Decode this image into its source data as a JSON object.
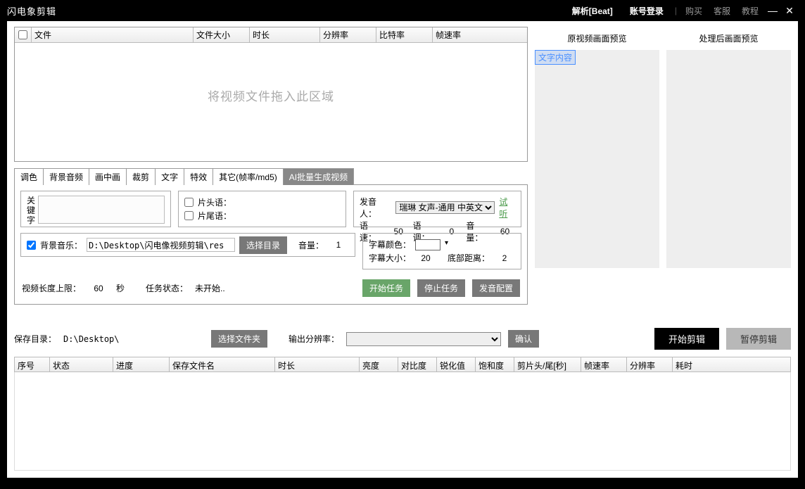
{
  "titlebar": {
    "title": "闪电象剪辑",
    "parse": "解析[Beat]",
    "login": "账号登录",
    "buy": "购买",
    "service": "客服",
    "tutorial": "教程"
  },
  "file_table": {
    "cols": [
      "文件",
      "文件大小",
      "时长",
      "分辨率",
      "比特率",
      "帧速率"
    ],
    "drop_hint": "将视频文件拖入此区域"
  },
  "tabs": [
    "调色",
    "背景音频",
    "画中画",
    "裁剪",
    "文字",
    "特效",
    "其它(帧率/md5)",
    "AI批量生成视频"
  ],
  "active_tab": "AI批量生成视频",
  "kw": {
    "label": "关键字",
    "value": ""
  },
  "phrase": {
    "head_label": "片头语：",
    "tail_label": "片尾语：",
    "head_on": false,
    "tail_on": false
  },
  "voice": {
    "speaker_label": "发音人：",
    "speaker": "瑞琳 女声-通用 中英文",
    "try": "试听",
    "speed_label": "语速：",
    "speed": "50",
    "pitch_label": "语调：",
    "pitch": "0",
    "vol_label": "音量：",
    "vol": "60"
  },
  "bgm": {
    "on": true,
    "label": "背景音乐：",
    "path": "D:\\Desktop\\闪电像视频剪辑\\res",
    "choose": "选择目录",
    "vol_label": "音量：",
    "vol": "1"
  },
  "subtitle": {
    "color_label": "字幕颜色：",
    "size_label": "字幕大小：",
    "size": "20",
    "bottom_label": "底部距离：",
    "bottom": "2"
  },
  "limit": {
    "label": "视频长度上限：",
    "value": "60",
    "unit": "秒"
  },
  "task": {
    "label": "任务状态：",
    "value": "未开始..",
    "start": "开始任务",
    "stop": "停止任务",
    "voicecfg": "发音配置"
  },
  "preview": {
    "orig": "原视频画面预览",
    "proc": "处理后画面预览",
    "text_tag": "文字内容"
  },
  "save": {
    "label": "保存目录：",
    "path": "D:\\Desktop\\",
    "choose": "选择文件夹",
    "res_label": "输出分辨率：",
    "confirm": "确认",
    "start": "开始剪辑",
    "pause": "暂停剪辑"
  },
  "result_cols": [
    "序号",
    "状态",
    "进度",
    "保存文件名",
    "时长",
    "亮度",
    "对比度",
    "锐化值",
    "饱和度",
    "剪片头/尾[秒]",
    "帧速率",
    "分辨率",
    "耗时"
  ]
}
